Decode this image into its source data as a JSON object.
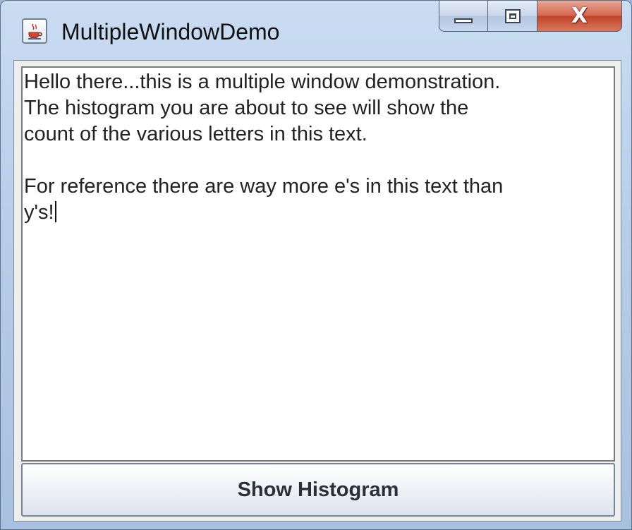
{
  "window": {
    "title": "MultipleWindowDemo",
    "icon": "java-cup-icon",
    "controls": {
      "minimize": "minimize-icon",
      "maximize": "maximize-icon",
      "close": "close-icon",
      "close_glyph": "X"
    }
  },
  "text_area": {
    "lines": [
      "Hello there...this is a multiple window demonstration.",
      "The histogram you are about to see will show the",
      "count of the various letters in this text.",
      "",
      "For reference there are way more e's in this text than",
      "y's!"
    ]
  },
  "button": {
    "label": "Show Histogram"
  },
  "colors": {
    "title_bar": "#b7cde8",
    "close_button": "#c0432a",
    "text_area_background": "#ffffff",
    "text": "#222222"
  }
}
